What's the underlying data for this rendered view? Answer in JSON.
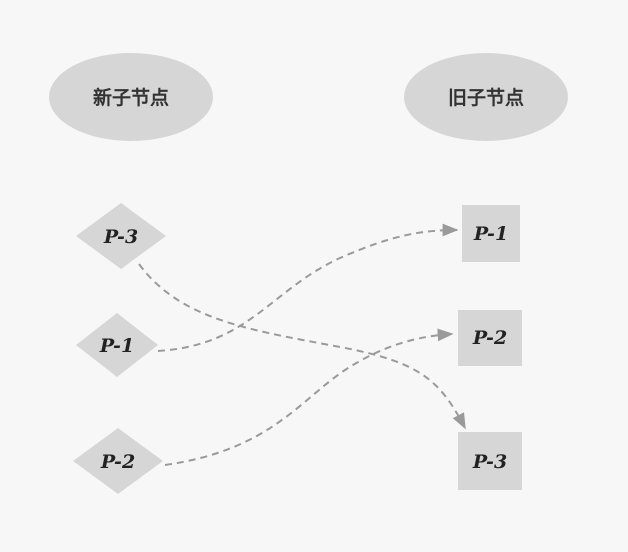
{
  "headers": {
    "new_label": "新子节点",
    "old_label": "旧子节点"
  },
  "new_nodes": [
    {
      "id": "new-p3",
      "label": "P-3"
    },
    {
      "id": "new-p1",
      "label": "P-1"
    },
    {
      "id": "new-p2",
      "label": "P-2"
    }
  ],
  "old_nodes": [
    {
      "id": "old-p1",
      "label": "P-1"
    },
    {
      "id": "old-p2",
      "label": "P-2"
    },
    {
      "id": "old-p3",
      "label": "P-3"
    }
  ],
  "connections": [
    {
      "from": "new-p3",
      "to": "old-p3"
    },
    {
      "from": "new-p1",
      "to": "old-p1"
    },
    {
      "from": "new-p2",
      "to": "old-p2"
    }
  ],
  "colors": {
    "background": "#f7f7f7",
    "shape_fill": "#d6d6d6",
    "connector": "#9a9a9a",
    "text": "#222222"
  }
}
